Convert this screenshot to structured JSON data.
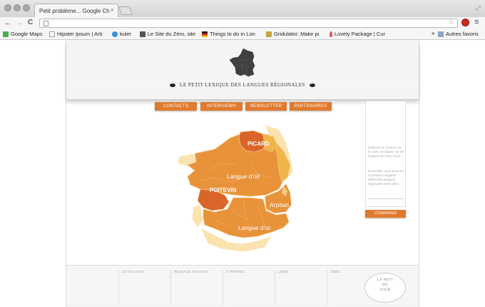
{
  "browser": {
    "tab_title": "Petit problème... Google Ch",
    "tab_close": "×",
    "menu_glyph": "≡",
    "back_glyph": "←",
    "forward_glyph": "→",
    "reload_glyph": "C",
    "star_glyph": "☆",
    "bookmarks": [
      {
        "label": "Google Maps",
        "color": "#4caf50"
      },
      {
        "label": "Hipster Ipsum | Arti",
        "color": "#ffffff"
      },
      {
        "label": "kuler",
        "color": "#3b8fd6"
      },
      {
        "label": "Le Site du Zéro, site",
        "color": "#555555"
      },
      {
        "label": "Things to do in Lon",
        "color": "#111111"
      },
      {
        "label": "Gridulator: Make pi",
        "color": "#c2a43a"
      },
      {
        "label": "Lovely Package | Cur",
        "color": "#e05a5a"
      }
    ],
    "more_bookmarks": "»",
    "other_bookmarks": "Autres favoris"
  },
  "site": {
    "title": "LE  PETIT LEXIQUE DES LANGUES RÉGIONALES",
    "nav": [
      "CONTACTS",
      "INTERVIEWS",
      "NEWSLETTER",
      "PARTENAIRES"
    ],
    "side_text_1": "Déplacez le curseur sur la carte, et cliquez sur les langues de votre choix.",
    "side_text_2": "Ensemble, nous pouvons à présent comparer différentes langues régionales entre elles.",
    "compare_button": "COMPARER",
    "map_labels": {
      "picard": "PICARD",
      "oil": "Langue d'oïl",
      "poitevin": "POITEVIN",
      "arpitan": "Arpitan",
      "oc": "Langue d'oc"
    },
    "footer_cols": [
      "ACTUALITÉS",
      "RÉSEAUX SOCIAUX",
      "À PROPOS",
      "LIENS",
      "JOBS"
    ],
    "mot_du_jour": [
      "LE MOT",
      "DU",
      "JOUR"
    ]
  },
  "colors": {
    "accent": "#e07a2e",
    "map_main": "#e8933a",
    "map_dark": "#d9652a",
    "map_light": "#f0b54a",
    "map_pale": "#fbe3b0"
  }
}
